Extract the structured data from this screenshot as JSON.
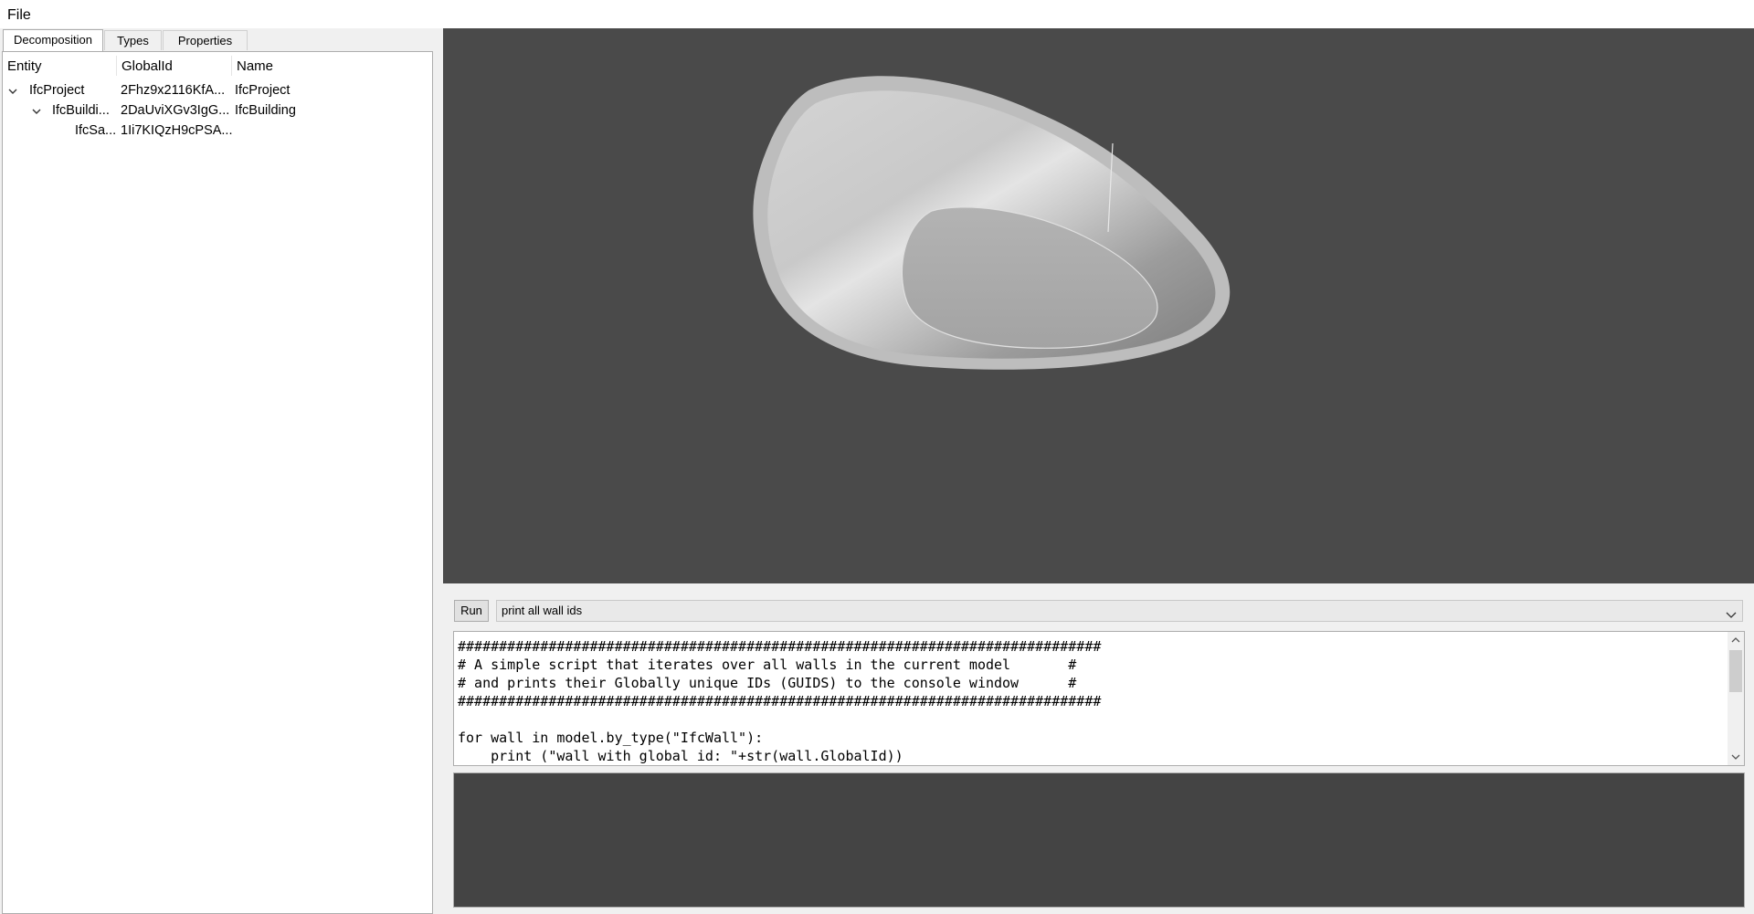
{
  "menu": {
    "file": "File"
  },
  "tabs": [
    {
      "label": "Decomposition",
      "active": true
    },
    {
      "label": "Types",
      "active": false
    },
    {
      "label": "Properties",
      "active": false
    }
  ],
  "tree": {
    "columns": [
      "Entity",
      "GlobalId",
      "Name"
    ],
    "rows": [
      {
        "entity": "IfcProject",
        "globalid": "2Fhz9x2116KfA...",
        "name": "IfcProject",
        "expanded": true
      },
      {
        "entity": "IfcBuildi...",
        "globalid": "2DaUviXGv3IgG...",
        "name": "IfcBuilding",
        "expanded": true
      },
      {
        "entity": "IfcSa...",
        "globalid": "1Ii7KIQzH9cPSA...",
        "name": ""
      }
    ]
  },
  "viewport": {
    "background": "#4a4a4a",
    "object": "sanitary-basin-model"
  },
  "run": {
    "button": "Run",
    "script_selected": "print all wall ids"
  },
  "editor": {
    "lines": [
      "##############################################################################",
      "# A simple script that iterates over all walls in the current model       #",
      "# and prints their Globally unique IDs (GUIDS) to the console window      #",
      "##############################################################################",
      "",
      "for wall in model.by_type(\"IfcWall\"):",
      "    print (\"wall with global id: \"+str(wall.GlobalId))"
    ]
  },
  "console": {
    "background": "#444444",
    "text": ""
  }
}
